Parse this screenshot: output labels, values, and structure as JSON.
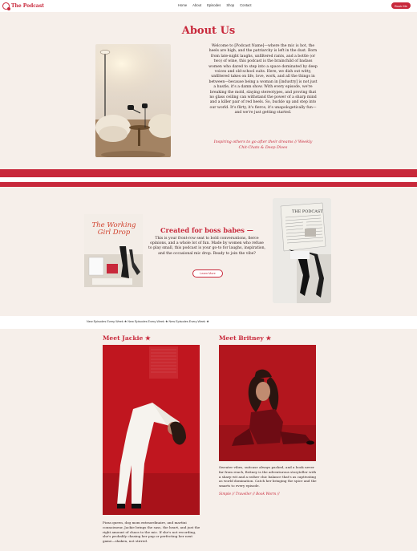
{
  "nav": {
    "logo_text": "The Podcast",
    "items": [
      "Home",
      "About",
      "Episodes",
      "Shop",
      "Contact"
    ],
    "cta_label": "Book Me"
  },
  "about": {
    "title": "About Us",
    "body": "Welcome to [Podcast Name]—where the mic is hot, the heels are high, and the patriarchy is left in the dust. Born from late-night laughs, unfiltered rants, and a bottle (or two) of wine, this podcast is the brainchild of badass women who dared to step into a space dominated by deep voices and old-school suits. Here, we dish out witty, unfiltered takes on life, love, work, and all the things in between—because being a woman in [industry] is not just a hustle, it's a damn show. With every episode, we're breaking the mold, slaying stereotypes, and proving that no glass ceiling can withstand the power of a sharp mind and a killer pair of red heels. So, buckle up and step into our world. It's flirty, it's fierce, it's unapologetically fun—and we're just getting started.",
    "tagline": "Inspiring others to go after their dreams // Weekly Chit-Chats & Deep Dives"
  },
  "boss": {
    "magazine_title": "The Working Girl Drop",
    "title": "Created for boss babes —",
    "body": "This is your front-row seat to bold conversations, fierce opinions, and a whole lot of fun. Made by women who refuse to play small, this podcast is your go-to for laughs, inspiration, and the occasional mic drop. Ready to join the vibe?",
    "button_label": "Learn More",
    "newspaper_title": "THE PODCAST"
  },
  "ticker": {
    "text": "New Episodes Every Week ★ New Episodes Every Week ★ New Episodes Every Week ★"
  },
  "hosts": {
    "jackie": {
      "name": "Meet Jackie ★",
      "bio": "Pizza queen, dog mom extraordinaire, and martini connoisseur, Jackie brings the sass, the heart, and just the right amount of chaos to the mic. If she's not recording, she's probably chasing her pup or perfecting her next game—shaken, not stirred."
    },
    "britney": {
      "name": "Meet Britney ★",
      "bio": "Sweater vibes, suitcase always packed, and a book never far from reach, Britney is the adventurous storyteller with a sharp wit and a rather chic balance that's as captivating as world domination. Catch her bringing the spice and the smarts to every episode.",
      "tags": "Simple // Traveller // Book Worm //"
    }
  },
  "colors": {
    "accent": "#c8283b",
    "background": "#f6efea"
  }
}
